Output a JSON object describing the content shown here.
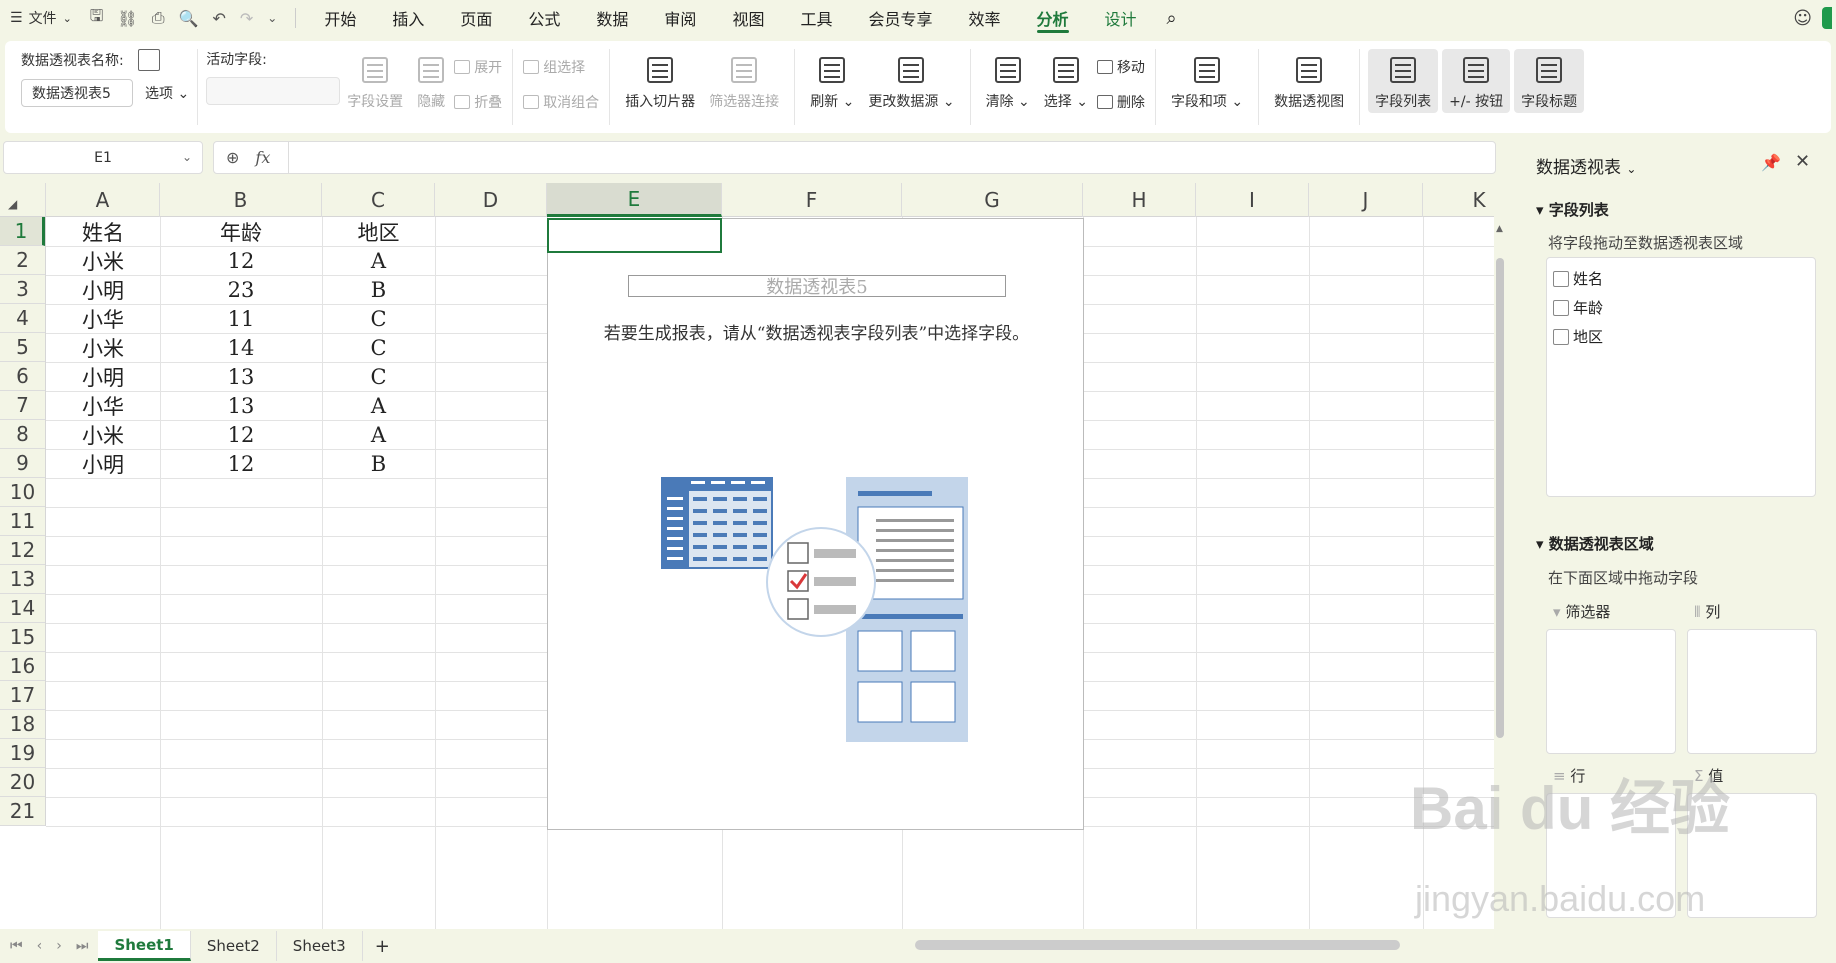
{
  "menu": {
    "file": "文件",
    "tabs": [
      "开始",
      "插入",
      "页面",
      "公式",
      "数据",
      "审阅",
      "视图",
      "工具",
      "会员专享",
      "效率",
      "分析",
      "设计"
    ],
    "active_tab": "分析"
  },
  "ribbon": {
    "pivot_name_label": "数据透视表名称:",
    "pivot_name_value": "数据透视表5",
    "options": "选项",
    "active_field_label": "活动字段:",
    "field_settings": "字段设置",
    "hide": "隐藏",
    "expand": "展开",
    "collapse": "折叠",
    "group_selection": "组选择",
    "ungroup": "取消组合",
    "insert_slicer": "插入切片器",
    "filter_connections": "筛选器连接",
    "refresh": "刷新",
    "change_source": "更改数据源",
    "clear": "清除",
    "select": "选择",
    "move": "移动",
    "delete": "删除",
    "fields_items": "字段和项",
    "pivot_chart": "数据透视图",
    "field_list": "字段列表",
    "buttons": "+/- 按钮",
    "field_headers": "字段标题"
  },
  "formula": {
    "cell_ref": "E1",
    "fx": "fx"
  },
  "grid": {
    "columns": [
      "A",
      "B",
      "C",
      "D",
      "E",
      "F",
      "G",
      "H",
      "I",
      "J",
      "K"
    ],
    "rows": [
      "1",
      "2",
      "3",
      "4",
      "5",
      "6",
      "7",
      "8",
      "9",
      "10",
      "11",
      "12",
      "13",
      "14",
      "15",
      "16",
      "17",
      "18",
      "19",
      "20",
      "21"
    ],
    "data": [
      [
        "姓名",
        "年龄",
        "地区"
      ],
      [
        "小米",
        "12",
        "A"
      ],
      [
        "小明",
        "23",
        "B"
      ],
      [
        "小华",
        "11",
        "C"
      ],
      [
        "小米",
        "14",
        "C"
      ],
      [
        "小明",
        "13",
        "C"
      ],
      [
        "小华",
        "13",
        "A"
      ],
      [
        "小米",
        "12",
        "A"
      ],
      [
        "小明",
        "12",
        "B"
      ]
    ]
  },
  "pivot": {
    "title": "数据透视表5",
    "message": "若要生成报表，请从“数据透视表字段列表”中选择字段。"
  },
  "sheets": [
    "Sheet1",
    "Sheet2",
    "Sheet3"
  ],
  "active_sheet": "Sheet1",
  "panel": {
    "title": "数据透视表",
    "field_list_section": "字段列表",
    "field_list_hint": "将字段拖动至数据透视表区域",
    "fields": [
      "姓名",
      "年龄",
      "地区"
    ],
    "areas_section": "数据透视表区域",
    "areas_hint": "在下面区域中拖动字段",
    "filter": "筛选器",
    "columns": "列",
    "rows": "行",
    "values": "值"
  },
  "watermark": {
    "brand": "Bai du 经验",
    "url": "jingyan.baidu.com"
  },
  "colors": {
    "accent": "#1f7a3c",
    "background": "#f3f5e6",
    "illustration_blue": "#4a7ab8",
    "illustration_light": "#c3d5ea"
  }
}
